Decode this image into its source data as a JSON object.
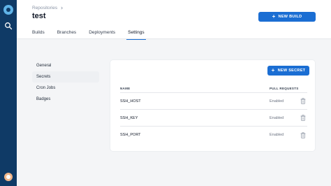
{
  "breadcrumb": {
    "parent": "Repositories"
  },
  "header": {
    "title": "test",
    "new_build_label": "NEW BUILD"
  },
  "tabs": [
    {
      "label": "Builds"
    },
    {
      "label": "Branches"
    },
    {
      "label": "Deployments"
    },
    {
      "label": "Settings",
      "active": true
    }
  ],
  "settings_nav": [
    {
      "label": "General"
    },
    {
      "label": "Secrets",
      "active": true
    },
    {
      "label": "Cron Jobs"
    },
    {
      "label": "Badges"
    }
  ],
  "secrets": {
    "new_secret_label": "NEW SECRET",
    "columns": [
      "NAME",
      "PULL REQUESTS"
    ],
    "rows": [
      {
        "name": "SSH_HOST",
        "pull_requests": "Enabled"
      },
      {
        "name": "SSH_KEY",
        "pull_requests": "Enabled"
      },
      {
        "name": "SSH_PORT",
        "pull_requests": "Enabled"
      }
    ]
  },
  "colors": {
    "accent": "#1b6ed3",
    "sidebar": "#0f3a66"
  },
  "icons": [
    "logo-icon",
    "search-icon",
    "chevron-right-icon",
    "plus-icon",
    "trash-icon",
    "avatar"
  ]
}
